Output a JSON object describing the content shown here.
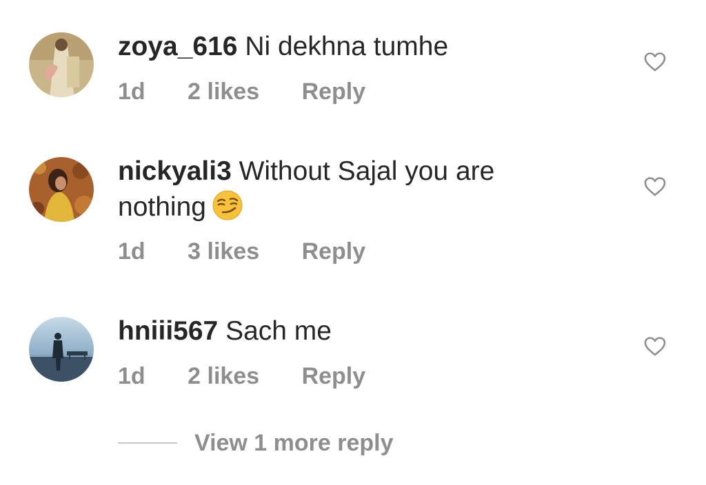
{
  "comments": [
    {
      "username": "zoya_616",
      "text": "Ni dekhna tumhe",
      "time": "1d",
      "likes": "2 likes",
      "reply_label": "Reply",
      "avatar": "woman-in-cream-outfit-avatar",
      "emoji": null
    },
    {
      "username": "nickyali3",
      "text": "Without Sajal you are nothing",
      "time": "1d",
      "likes": "3 likes",
      "reply_label": "Reply",
      "avatar": "woman-in-autumn-leaves-avatar",
      "emoji": "smirking-face"
    },
    {
      "username": "hniii567",
      "text": "Sach me",
      "time": "1d",
      "likes": "2 likes",
      "reply_label": "Reply",
      "avatar": "man-silhouette-seaside-avatar",
      "emoji": null
    }
  ],
  "view_more_label": "View 1 more reply",
  "icons": {
    "like": "heart-outline-icon"
  },
  "colors": {
    "text": "#262626",
    "secondary_text": "#8e8e8e",
    "heart_stroke": "#8e8e8e"
  }
}
